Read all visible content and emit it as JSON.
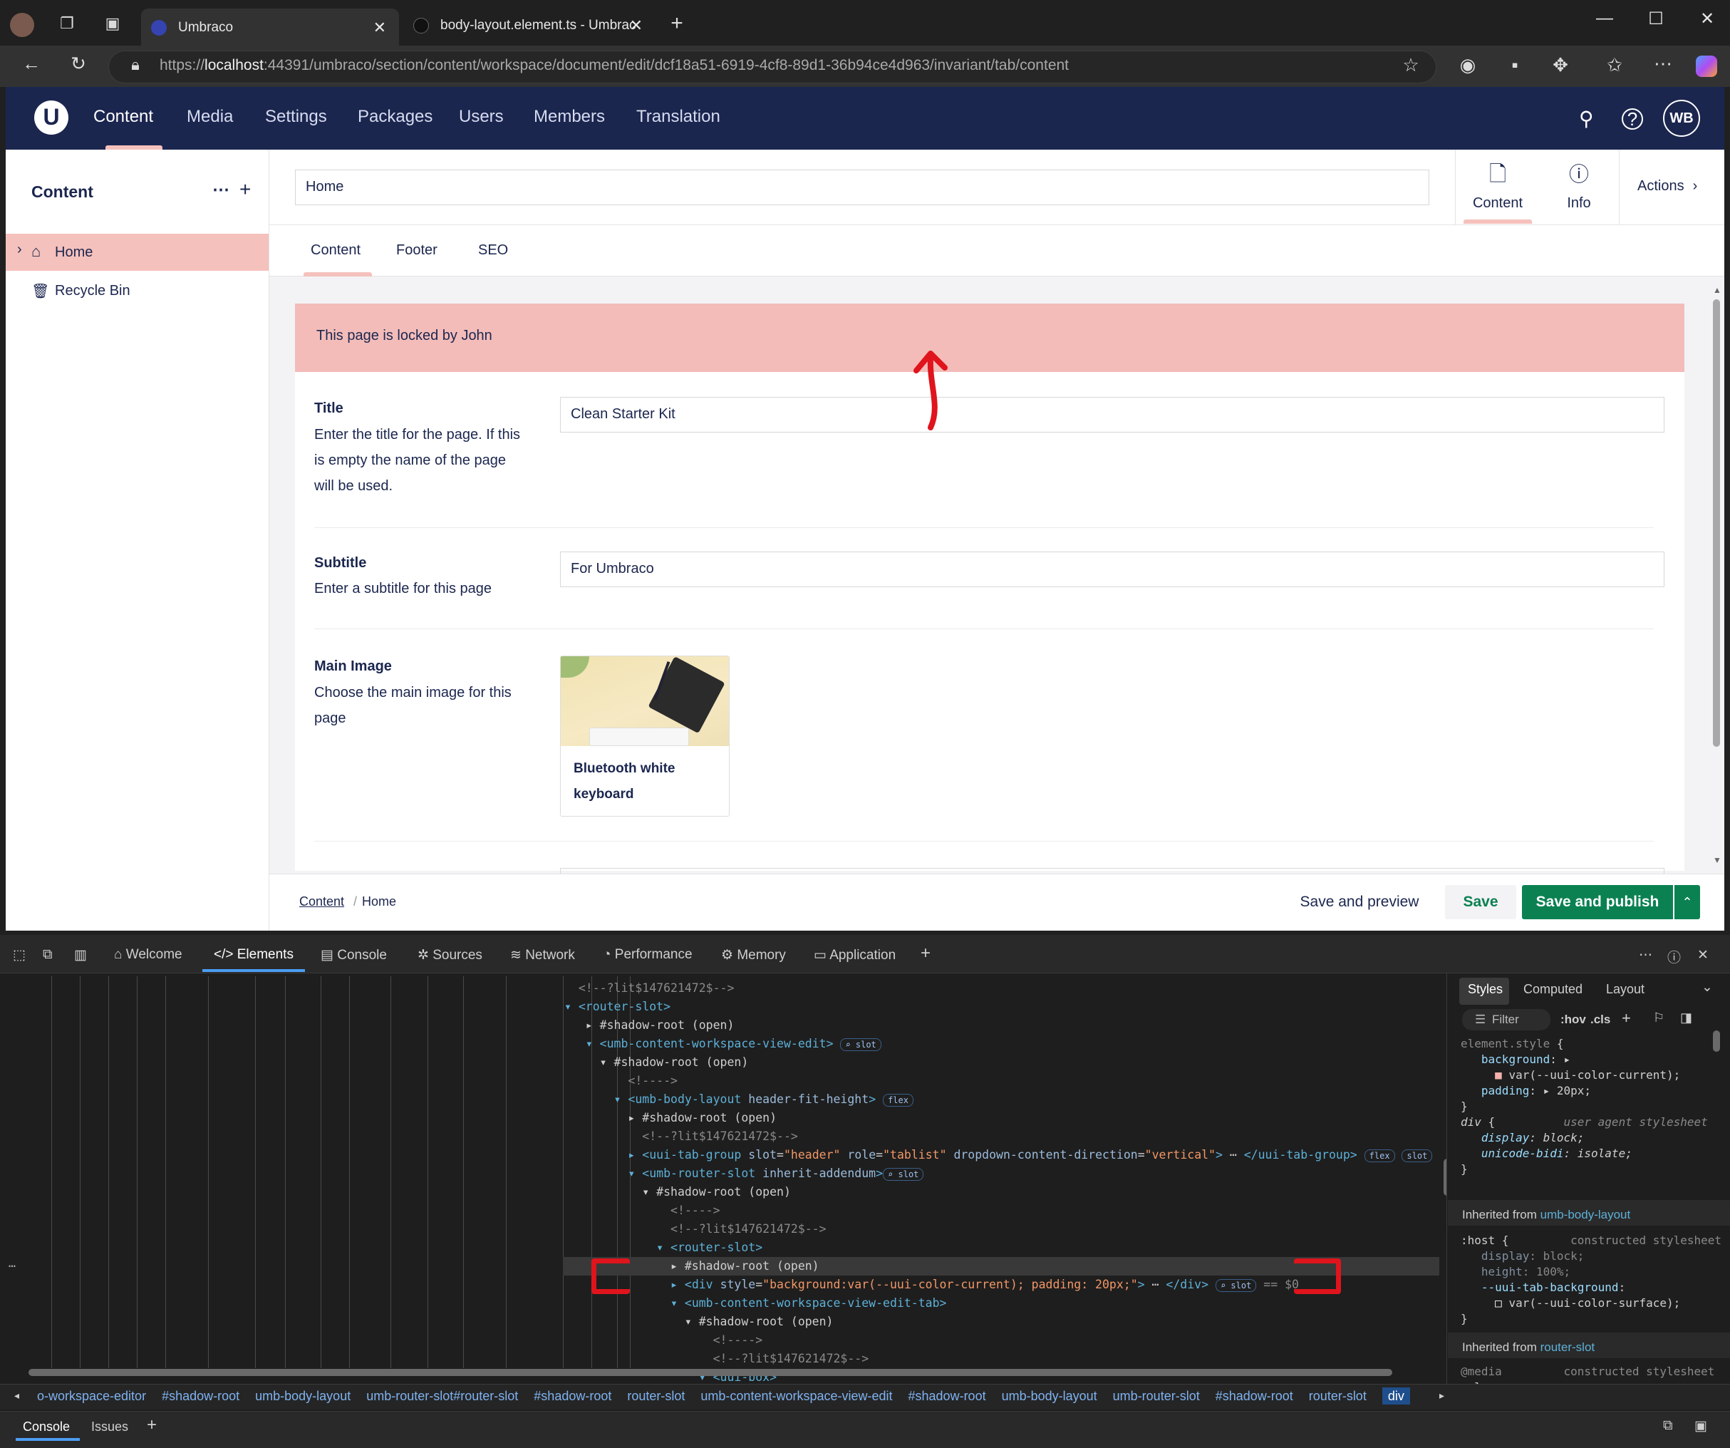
{
  "browser": {
    "tabs": [
      {
        "label": "Umbraco",
        "active": true
      },
      {
        "label": "body-layout.element.ts - Umbrac",
        "active": false
      }
    ],
    "url_prefix": "https://",
    "url_host": "localhost",
    "url_rest": ":44391/umbraco/section/content/workspace/document/edit/dcf18a51-6919-4cf8-89d1-36b94ce4d963/invariant/tab/content",
    "icons": [
      "back-icon",
      "refresh-icon",
      "lock-icon",
      "star-icon",
      "extensions-icon",
      "favorites-icon",
      "more-icon",
      "copilot-icon"
    ]
  },
  "header": {
    "nav": [
      "Content",
      "Media",
      "Settings",
      "Packages",
      "Users",
      "Members",
      "Translation"
    ],
    "active_nav": "Content",
    "avatar": "WB"
  },
  "sidebar": {
    "title": "Content",
    "items": [
      "Home",
      "Recycle Bin"
    ]
  },
  "workspace": {
    "name": "Home",
    "views": [
      "Content",
      "Info"
    ],
    "actions": "Actions",
    "tabs": [
      "Content",
      "Footer",
      "SEO"
    ],
    "locked_message": "This page is locked by John",
    "properties": [
      {
        "label": "Title",
        "description": "Enter the title for the page. If this is empty the name of the page will be used.",
        "value": "Clean Starter Kit"
      },
      {
        "label": "Subtitle",
        "description": "Enter a subtitle for this page",
        "value": "For Umbraco"
      },
      {
        "label": "Main Image",
        "description": "Choose the main image for this page",
        "media_name": "Bluetooth white keyboard"
      }
    ],
    "breadcrumb": [
      "Content",
      "Home"
    ],
    "buttons": {
      "preview": "Save and preview",
      "save": "Save",
      "publish": "Save and publish"
    }
  },
  "devtools": {
    "tabs": [
      "Welcome",
      "Elements",
      "Console",
      "Sources",
      "Network",
      "Performance",
      "Memory",
      "Application"
    ],
    "active_tab": "Elements",
    "styles_tabs": [
      "Styles",
      "Computed",
      "Layout"
    ],
    "filter_placeholder": "Filter",
    "hov": ":hov",
    "cls": ".cls",
    "breadcrumbs": [
      "o-workspace-editor",
      "#shadow-root",
      "umb-body-layout",
      "umb-router-slot#router-slot",
      "#shadow-root",
      "router-slot",
      "umb-content-workspace-view-edit",
      "#shadow-root",
      "umb-body-layout",
      "umb-router-slot",
      "#shadow-root",
      "router-slot",
      "div"
    ],
    "drawer_tabs": [
      "Console",
      "Issues"
    ]
  },
  "colors": {
    "brand": "#1b264f",
    "accent": "#f5c1bc",
    "locked_bg": "#f3bcb9",
    "publish": "#0b8152",
    "annotation": "#e0141c"
  }
}
